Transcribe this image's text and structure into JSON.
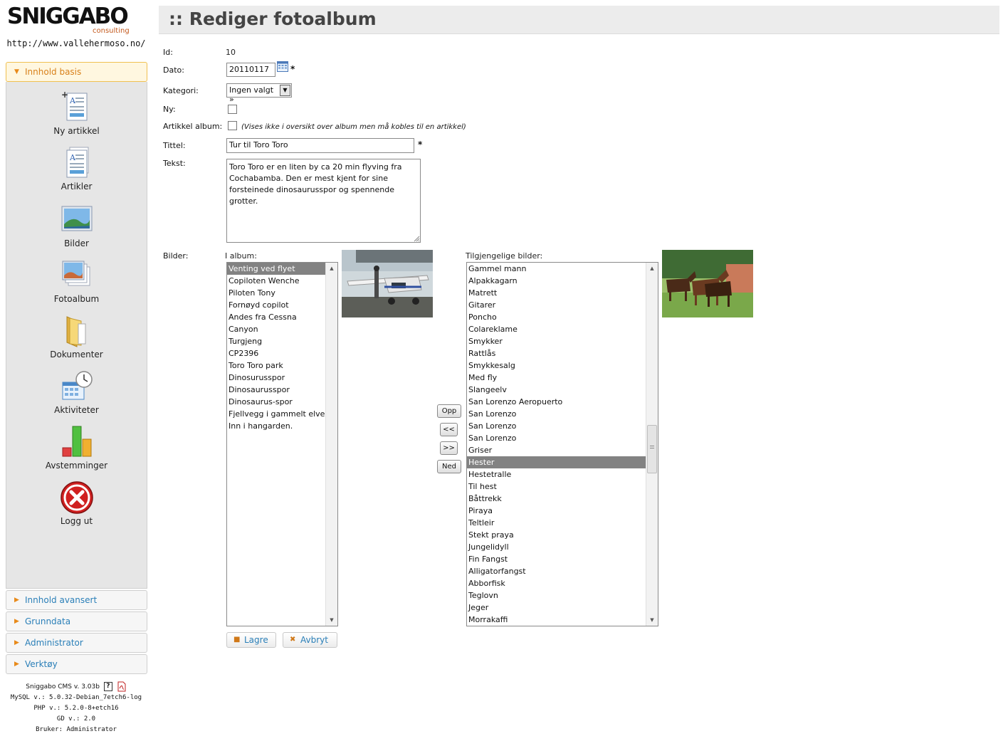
{
  "sidebar": {
    "logo": {
      "brand": "SNIGGABO",
      "sub": "consulting"
    },
    "site_url": "http://www.vallehermoso.no/",
    "sections": {
      "main": "Innhold basis",
      "advanced": "Innhold avansert",
      "basedata": "Grunndata",
      "admin": "Administrator",
      "tools": "Verktøy"
    },
    "items": [
      {
        "label": "Ny artikkel",
        "icon": "new-article-icon"
      },
      {
        "label": "Artikler",
        "icon": "articles-icon"
      },
      {
        "label": "Bilder",
        "icon": "images-icon"
      },
      {
        "label": "Fotoalbum",
        "icon": "photo-album-icon"
      },
      {
        "label": "Dokumenter",
        "icon": "folder-icon"
      },
      {
        "label": "Aktiviteter",
        "icon": "calendar-clock-icon"
      },
      {
        "label": "Avstemminger",
        "icon": "bar-chart-icon"
      },
      {
        "label": "Logg ut",
        "icon": "logout-icon"
      }
    ],
    "system": {
      "cms": "Sniggabo CMS v. 3.03b",
      "mysql": "MySQL v.: 5.0.32-Debian_7etch6-log",
      "php": "PHP v.: 5.2.0-8+etch16",
      "gd": "GD v.: 2.0",
      "user": "Bruker: Administrator"
    }
  },
  "page": {
    "title": ":: Rediger fotoalbum"
  },
  "form": {
    "id_label": "Id:",
    "id_value": "10",
    "date_label": "Dato:",
    "date_value": "20110117",
    "category_label": "Kategori:",
    "category_value": "Ingen valgt »",
    "new_label": "Ny:",
    "article_album_label": "Artikkel album:",
    "article_album_note": "(Vises ikke i oversikt over album men må kobles til en artikkel)",
    "title_label": "Tittel:",
    "title_value": "Tur til Toro Toro",
    "text_label": "Tekst:",
    "text_value": "Toro Toro er en liten by ca 20 min flyving fra Cochabamba. Den er mest kjent for sine forsteinede dinosaurusspor og spennende grotter.",
    "required_mark": "*",
    "images_label": "Bilder:",
    "in_album_label": "I album:",
    "available_label": "Tilgjengelige bilder:",
    "in_album": [
      "Venting ved flyet",
      "Copiloten Wenche",
      "Piloten Tony",
      "Fornøyd copilot",
      "Andes fra Cessna",
      "Canyon",
      "Turgjeng",
      "CP2396",
      "Toro Toro park",
      "Dinosurusspor",
      "Dinosaurusspor",
      "Dinosaurus-spor",
      "Fjellvegg i gammelt elveleie",
      "Inn i hangarden."
    ],
    "in_album_selected": 0,
    "available": [
      "Gammel mann",
      "Alpakkagarn",
      "Matrett",
      "Gitarer",
      "Poncho",
      "Colareklame",
      "Smykker",
      "Rattlås",
      "Smykkesalg",
      "Med fly",
      "Slangeelv",
      "San Lorenzo Aeropuerto",
      "San Lorenzo",
      "San Lorenzo",
      "San Lorenzo",
      "Griser",
      "Hester",
      "Hestetralle",
      "Til hest",
      "Båttrekk",
      "Piraya",
      "Teltleir",
      "Stekt praya",
      "Jungelidyll",
      "Fin Fangst",
      "Alligatorfangst",
      "Abborfisk",
      "Teglovn",
      "Jeger",
      "Morrakaffi"
    ],
    "available_selected": 16,
    "buttons": {
      "up": "Opp",
      "add": "<<",
      "remove": ">>",
      "down": "Ned",
      "save": "Lagre",
      "cancel": "Avbryt"
    }
  }
}
